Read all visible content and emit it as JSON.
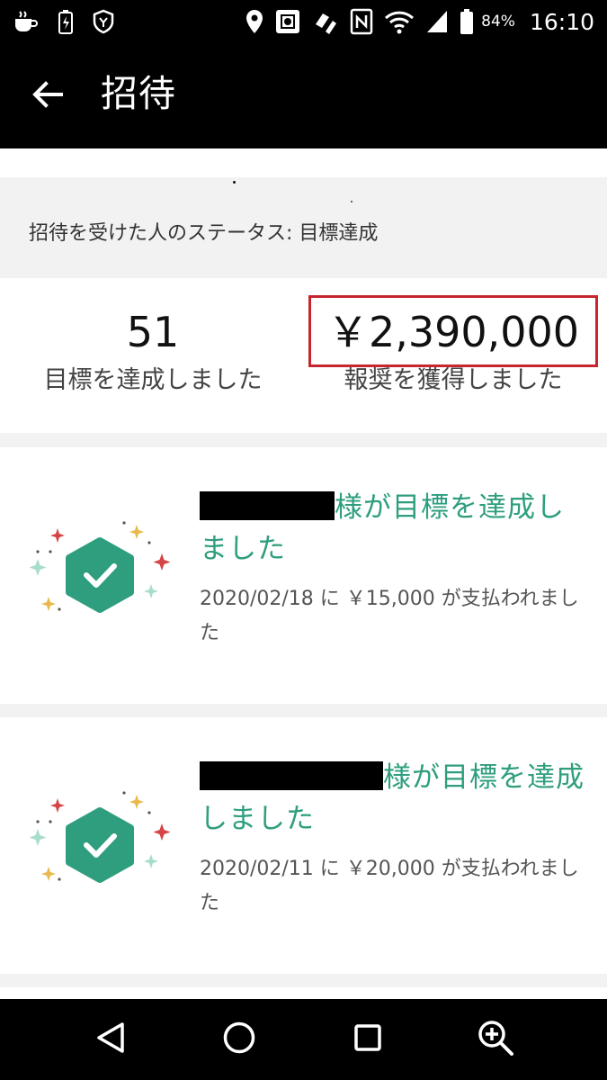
{
  "status_bar": {
    "battery_percent": "84%",
    "time": "16:10",
    "left_icons": [
      "coffee-cup-icon",
      "battery-saver-icon",
      "shield-app-icon"
    ],
    "right_icons": [
      "location-pin-icon",
      "screenshot-app-icon",
      "sync-app-icon",
      "nfc-icon",
      "wifi-icon",
      "cell-signal-icon",
      "battery-icon"
    ]
  },
  "app_bar": {
    "back_icon": "arrow-left-icon",
    "title": "招待"
  },
  "invitee_status": {
    "text": "招待を受けた人のステータス: 目標達成"
  },
  "summary": {
    "goals_count": "51",
    "goals_label": "目標を達成しました",
    "reward_amount": "￥2,390,000",
    "reward_label": "報奨を獲得しました",
    "highlight_color": "#c8262e"
  },
  "achievements": [
    {
      "title_suffix": "様が目標を達成しました",
      "detail": "2020/02/18 に ￥15,000 が支払われました"
    },
    {
      "title_suffix": "様が目標を達成しました",
      "detail": "2020/02/11 に ￥20,000 が支払われました"
    }
  ],
  "colors": {
    "accent_green": "#2e9e7e",
    "badge_green": "#2e9e7e",
    "background_gray": "#f2f2f2"
  },
  "nav_bar": {
    "icons": [
      "back-triangle-icon",
      "home-circle-icon",
      "recents-square-icon",
      "zoom-in-icon"
    ]
  }
}
